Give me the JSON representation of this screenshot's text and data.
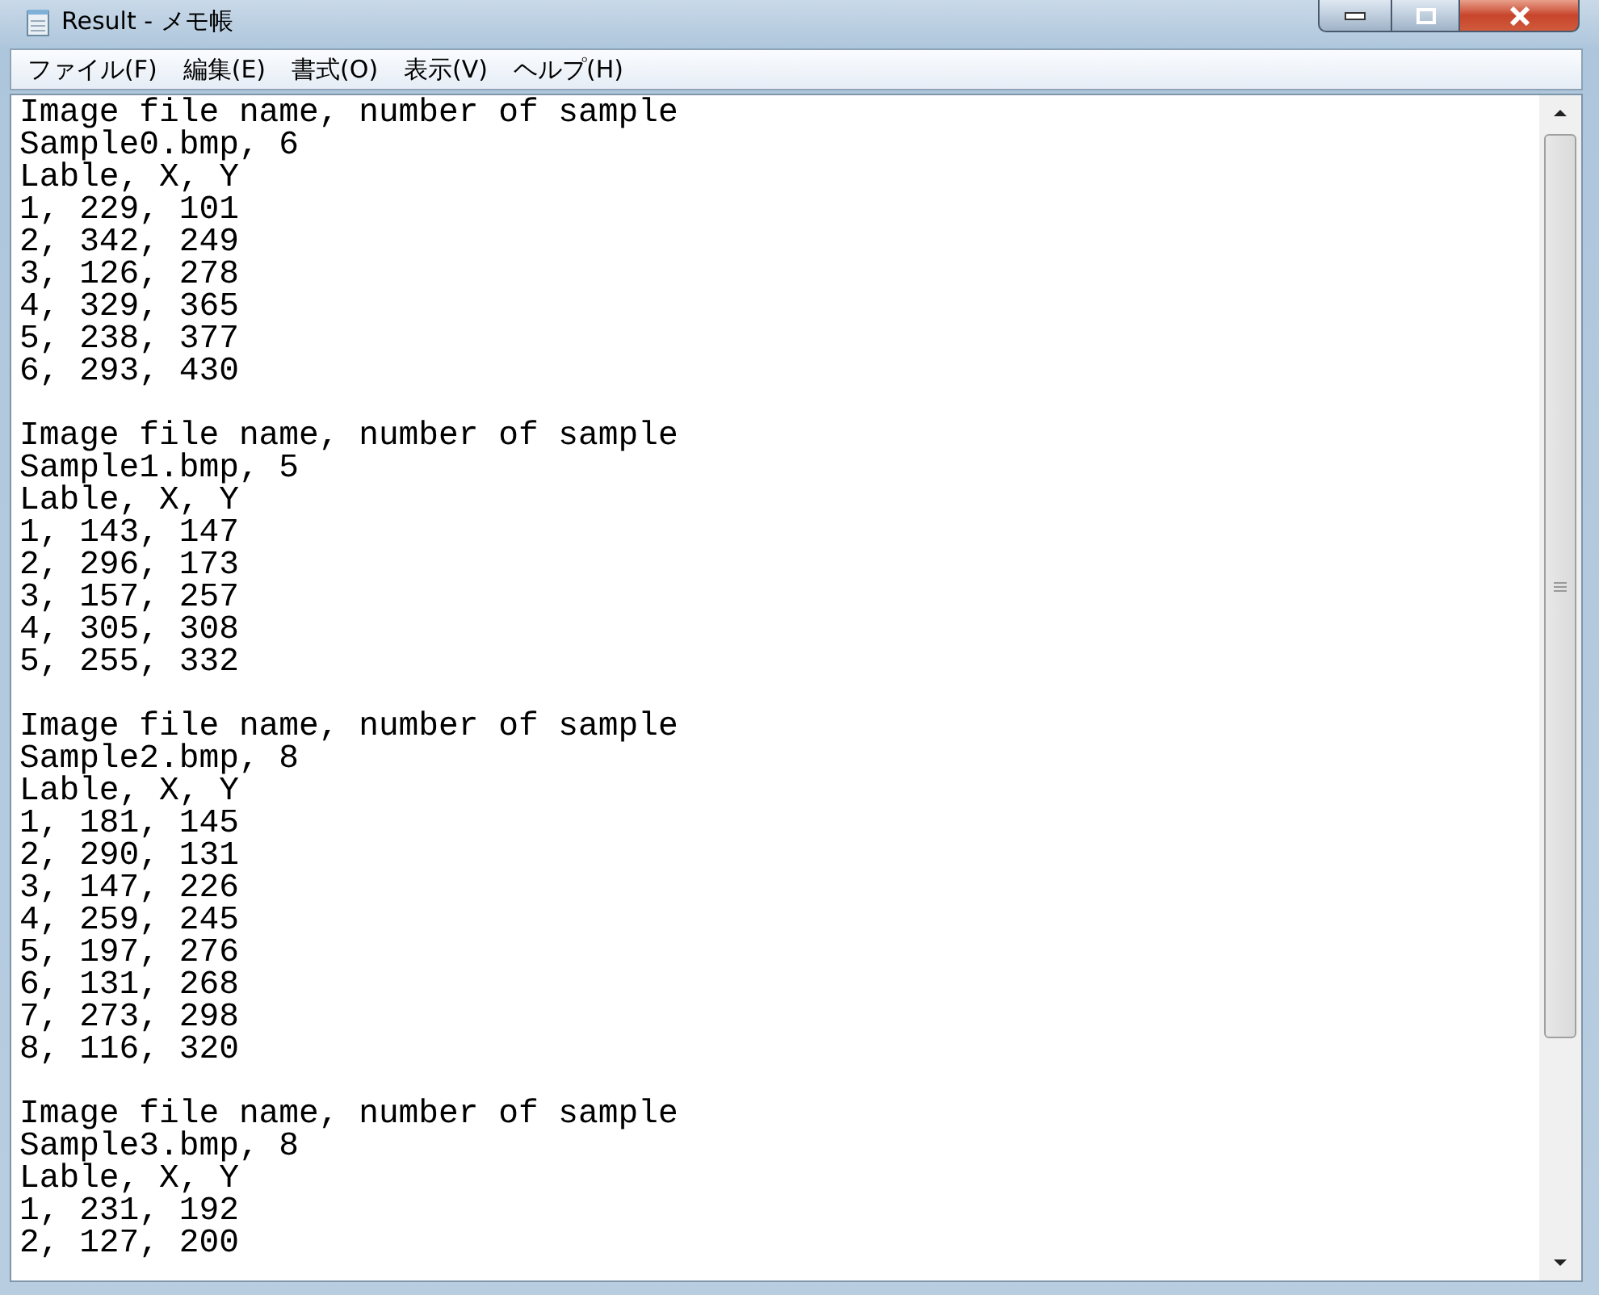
{
  "window": {
    "title": "Result - メモ帳"
  },
  "menu": [
    "ファイル(F)",
    "編集(E)",
    "書式(O)",
    "表示(V)",
    "ヘルプ(H)"
  ],
  "document": {
    "blocks": [
      {
        "lines": [
          "Image file name, number of sample",
          "Sample0.bmp, 6",
          "Lable, X, Y",
          "1, 229, 101",
          "2, 342, 249",
          "3, 126, 278",
          "4, 329, 365",
          "5, 238, 377",
          "6, 293, 430"
        ]
      },
      {
        "lines": [
          "Image file name, number of sample",
          "Sample1.bmp, 5",
          "Lable, X, Y",
          "1, 143, 147",
          "2, 296, 173",
          "3, 157, 257",
          "4, 305, 308",
          "5, 255, 332"
        ]
      },
      {
        "lines": [
          "Image file name, number of sample",
          "Sample2.bmp, 8",
          "Lable, X, Y",
          "1, 181, 145",
          "2, 290, 131",
          "3, 147, 226",
          "4, 259, 245",
          "5, 197, 276",
          "6, 131, 268",
          "7, 273, 298",
          "8, 116, 320"
        ]
      },
      {
        "lines": [
          "Image file name, number of sample",
          "Sample3.bmp, 8",
          "Lable, X, Y",
          "1, 231, 192",
          "2, 127, 200"
        ]
      }
    ]
  }
}
